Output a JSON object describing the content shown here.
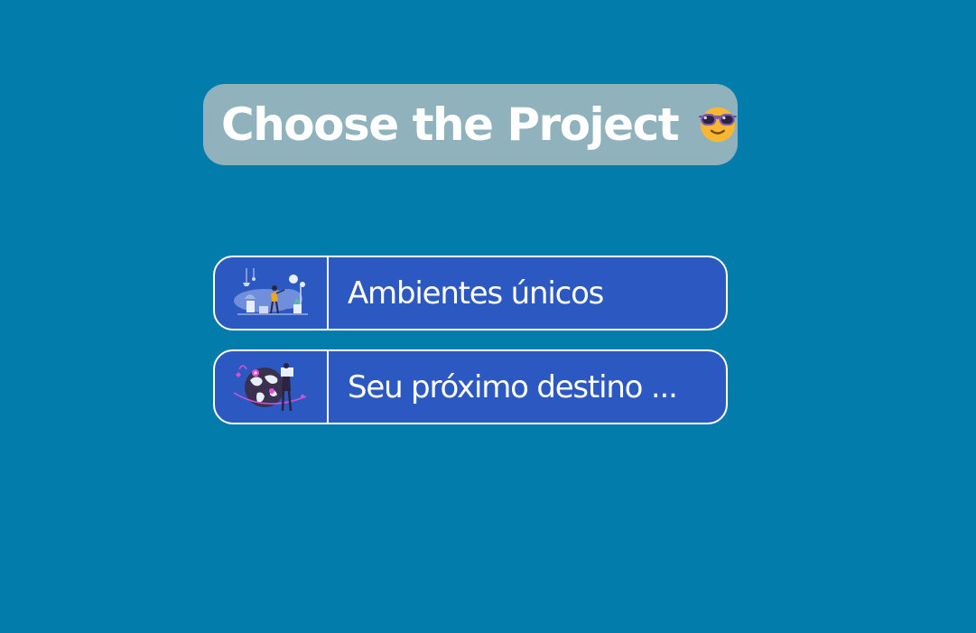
{
  "header": {
    "title": "Choose the Project",
    "emoji_icon": "sunglasses-face-icon"
  },
  "projects": [
    {
      "label": "Ambientes únicos",
      "icon": "interior-design-illustration"
    },
    {
      "label": "Seu próximo destino ...",
      "icon": "world-travel-illustration"
    }
  ],
  "colors": {
    "background": "#027cab",
    "title_pill": "#8fb2bd",
    "card": "#2c59c1",
    "border": "#ffffff"
  }
}
